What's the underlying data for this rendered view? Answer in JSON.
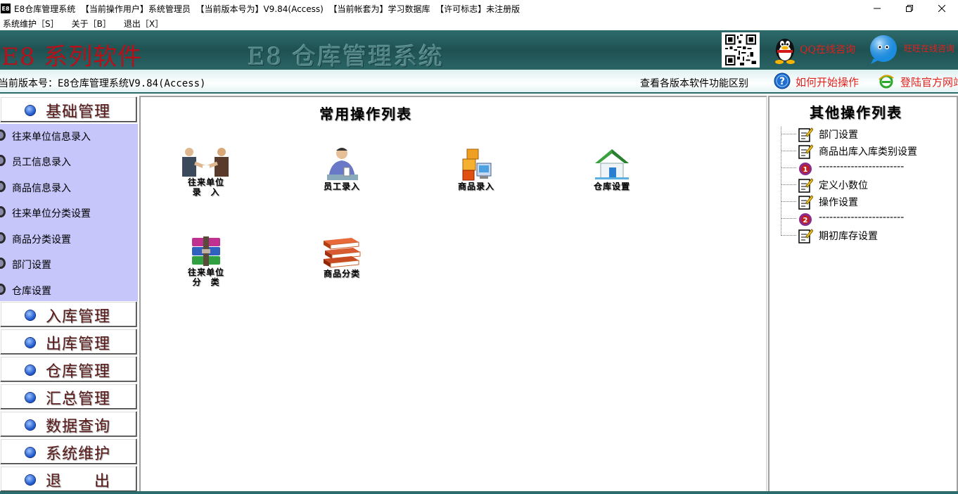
{
  "window": {
    "icon_text": "E8",
    "title": "E8仓库管理系统  【当前操作用户】系统管理员  【当前版本号为】V9.84(Access)  【当前帐套为】学习数据库  【许可标志】未注册版"
  },
  "menu": [
    "系统维护［S］",
    "关于［B］",
    "退出［X］"
  ],
  "banner": {
    "title": "E8 系列软件",
    "subtitle": "E8 仓库管理系统",
    "qq_text": "QQ在线咨询",
    "chat_text": "旺旺在线咨询"
  },
  "infobar": {
    "version": "当前版本号：E8仓库管理系统V9.84(Access)",
    "compare": "查看各版本软件功能区别",
    "help": "如何开始操作",
    "website": "登陆官方网站"
  },
  "sidebar": {
    "top_category": "基础管理",
    "sub_items": [
      "往来单位信息录入",
      "员工信息录入",
      "商品信息录入",
      "往来单位分类设置",
      "商品分类设置",
      "部门设置",
      "仓库设置"
    ],
    "categories": [
      "入库管理",
      "出库管理",
      "仓库管理",
      "汇总管理",
      "数据查询",
      "系统维护",
      "退　　出"
    ]
  },
  "main": {
    "title": "常用操作列表",
    "tiles": [
      {
        "line1": "往来单位",
        "line2": "录　入",
        "icon": "handshake-icon"
      },
      {
        "line1": "员工录入",
        "line2": "",
        "icon": "employee-icon"
      },
      {
        "line1": "商品录入",
        "line2": "",
        "icon": "goods-icon"
      },
      {
        "line1": "仓库设置",
        "line2": "",
        "icon": "warehouse-icon"
      },
      {
        "line1": "往来单位",
        "line2": "分　类",
        "icon": "archive-stack-icon"
      },
      {
        "line1": "商品分类",
        "line2": "",
        "icon": "books-icon"
      }
    ]
  },
  "right": {
    "title": "其他操作列表",
    "nodes": [
      {
        "text": "部门设置",
        "icon": "edit-doc-icon"
      },
      {
        "text": "商品出库入库类别设置",
        "icon": "edit-doc-icon"
      },
      {
        "text": "------------------------",
        "icon": "number-1-icon"
      },
      {
        "text": "定义小数位",
        "icon": "edit-doc-icon"
      },
      {
        "text": "操作设置",
        "icon": "edit-doc-icon"
      },
      {
        "text": "------------------------",
        "icon": "number-2-icon"
      },
      {
        "text": "期初库存设置",
        "icon": "edit-doc-icon"
      }
    ]
  },
  "colors": {
    "banner_bg": "#1f5152",
    "accent_red": "#e0211c",
    "sidebar_sub_bg": "#c6c6fb"
  }
}
